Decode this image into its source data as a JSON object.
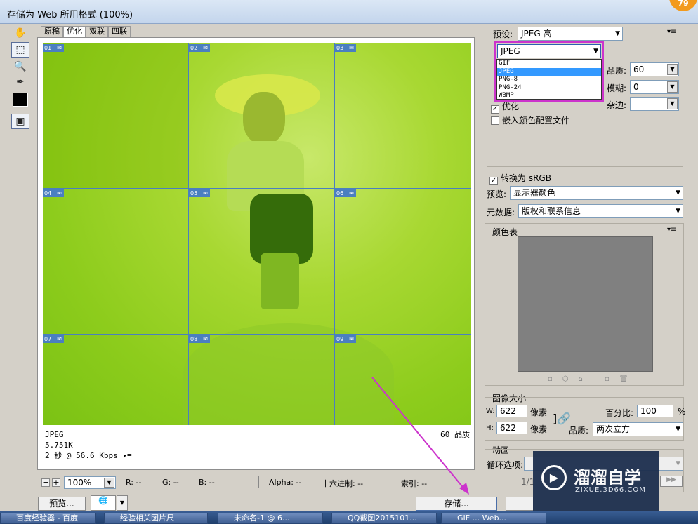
{
  "window": {
    "title": "存储为 Web 所用格式 (100%)",
    "badge": "79"
  },
  "tabs": [
    "原稿",
    "优化",
    "双联",
    "四联"
  ],
  "slices": [
    "01",
    "02",
    "03",
    "04",
    "05",
    "06",
    "07",
    "08",
    "09"
  ],
  "info": {
    "format": "JPEG",
    "size": "5.751K",
    "time": "2 秒 @ 56.6 Kbps",
    "quality": "60 品质"
  },
  "status": {
    "zoom": "100%",
    "r": "R: --",
    "g": "G: --",
    "b": "B: --",
    "alpha": "Alpha: --",
    "hex": "十六进制: --",
    "index": "索引: --"
  },
  "buttons": {
    "preview": "预览...",
    "save": "存储..."
  },
  "preset": {
    "label": "预设:",
    "value": "JPEG 高"
  },
  "format_dropdown": {
    "value": "JPEG",
    "options": [
      "GIF",
      "JPEG",
      "PNG-8",
      "PNG-24",
      "WBMP"
    ],
    "selected": "JPEG"
  },
  "quality": {
    "label": "品质:",
    "value": "60"
  },
  "blur": {
    "label": "模糊:",
    "value": "0"
  },
  "matte": {
    "label": "杂边:",
    "value": ""
  },
  "checks": {
    "optimize": "优化",
    "embed_profile": "嵌入颜色配置文件",
    "convert_srgb": "转换为 sRGB"
  },
  "preview_mode": {
    "label": "预览:",
    "value": "显示器颜色"
  },
  "metadata": {
    "label": "元数据:",
    "value": "版权和联系信息"
  },
  "color_table": {
    "label": "颜色表"
  },
  "image_size": {
    "label": "图像大小",
    "w_label": "W:",
    "w_value": "622",
    "w_unit": "像素",
    "h_label": "H:",
    "h_value": "622",
    "h_unit": "像素",
    "percent_label": "百分比:",
    "percent_value": "100",
    "percent_unit": "%",
    "quality_label": "品质:",
    "quality_value": "两次立方"
  },
  "animation": {
    "label": "动画",
    "loop_label": "循环选项:",
    "frame": "1/1"
  },
  "taskbar": [
    "百度经验器 - 百度",
    "经验相关图片尺",
    "未命名-1 @ 6...",
    "QQ截图2015101...",
    "GIF ... Web..."
  ],
  "watermark": {
    "brand": "溜溜自学",
    "url": "ZIXUE.3D66.COM"
  },
  "colors": {
    "accent_purple": "#cc33cc",
    "slice_blue": "#4a7fc0",
    "photo_green": "#8dcc1c"
  }
}
